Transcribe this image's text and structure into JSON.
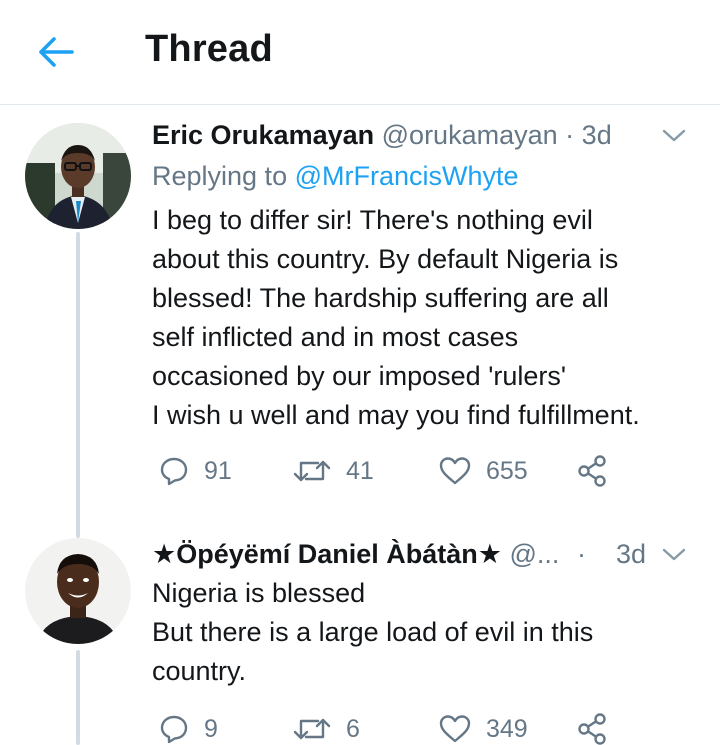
{
  "header": {
    "title": "Thread",
    "back_icon": "arrow-left-icon",
    "accent_color": "#1da1f2"
  },
  "tweets": [
    {
      "display_name": "Eric Orukamayan",
      "handle": "@orukamayan",
      "dot": "·",
      "time": "3d",
      "replying_prefix": "Replying to",
      "replying_to": "@MrFrancisWhyte",
      "body": [
        "I beg to differ sir! There's nothing evil",
        "about this country. By default Nigeria is",
        "blessed!  The hardship suffering are all",
        "self inflicted and in most cases",
        "occasioned by our imposed 'rulers'",
        "I wish u well and may you find fulfillment."
      ],
      "replies": "91",
      "retweets": "41",
      "likes": "655"
    },
    {
      "display_name": "★Öpéyëmí Daniel Àbátàn★",
      "handle": "@...",
      "dot": "·",
      "time": "3d",
      "body": [
        "Nigeria is blessed",
        "But there is a large load of evil in this",
        "country."
      ],
      "replies": "9",
      "retweets": "6",
      "likes": "349"
    }
  ],
  "colors": {
    "text_primary": "#14171a",
    "text_secondary": "#657786",
    "link": "#1da1f2",
    "divider": "#e1e8ed"
  }
}
